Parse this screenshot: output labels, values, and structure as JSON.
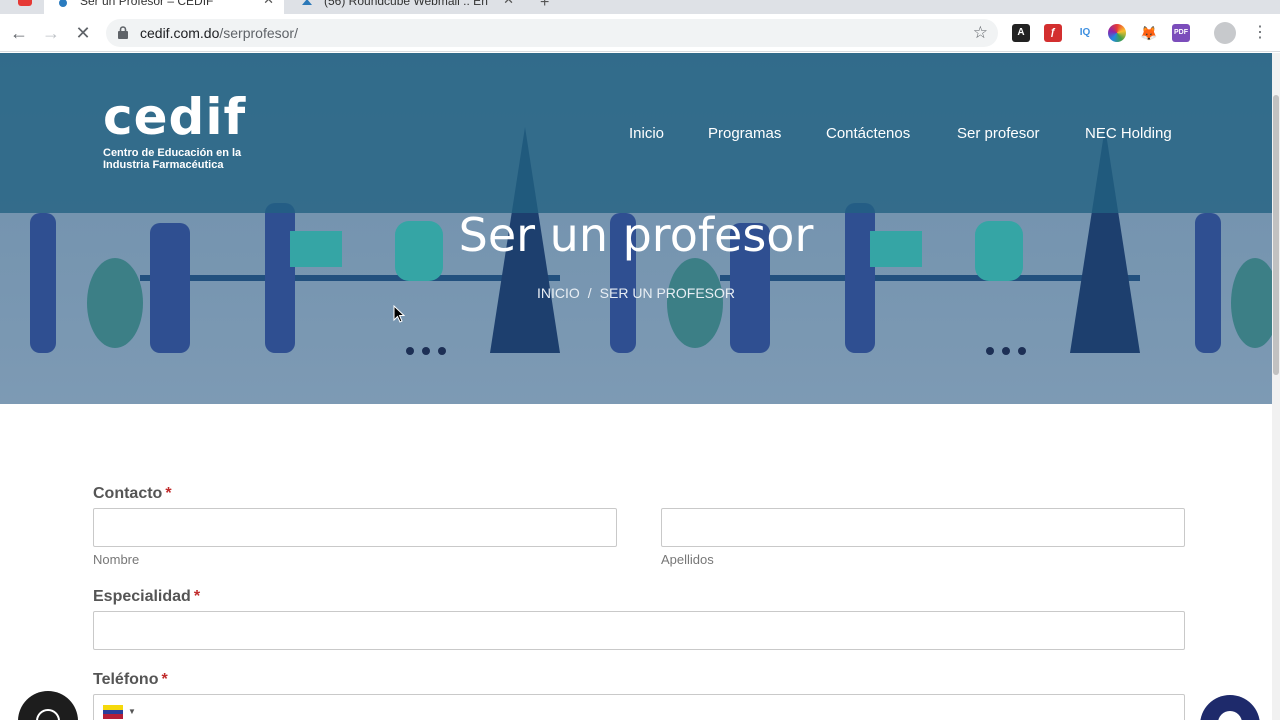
{
  "browser": {
    "tabs": [
      {
        "title": "Ser un Profesor – CEDIF",
        "active": true
      },
      {
        "title": "(56) Roundcube Webmail :: En",
        "active": false
      }
    ],
    "url_domain": "cedif.com.do",
    "url_path": "/serprofesor/",
    "extensions": [
      "acrobat-icon",
      "flash-icon",
      "iq-icon",
      "color-wheel-icon",
      "metamask-icon",
      "pdf-icon"
    ]
  },
  "site": {
    "logo_word": "cedif",
    "logo_sub_line1": "Centro de Educación en la",
    "logo_sub_line2": "Industria Farmacéutica",
    "nav": [
      "Inicio",
      "Programas",
      "Contáctenos",
      "Ser profesor",
      "NEC Holding"
    ],
    "page_title": "Ser un profesor",
    "breadcrumb": {
      "home": "INICIO",
      "separator": "/",
      "current": "SER UN PROFESOR"
    }
  },
  "form": {
    "contacto_label": "Contacto",
    "required_mark": "*",
    "nombre_sublabel": "Nombre",
    "apellidos_sublabel": "Apellidos",
    "especialidad_label": "Especialidad",
    "telefono_label": "Teléfono"
  },
  "colors": {
    "header_overlay": "#216282",
    "hero_bg": "#7d9ab4",
    "required": "#c02b2b",
    "chat_button": "#1e2a6b"
  }
}
